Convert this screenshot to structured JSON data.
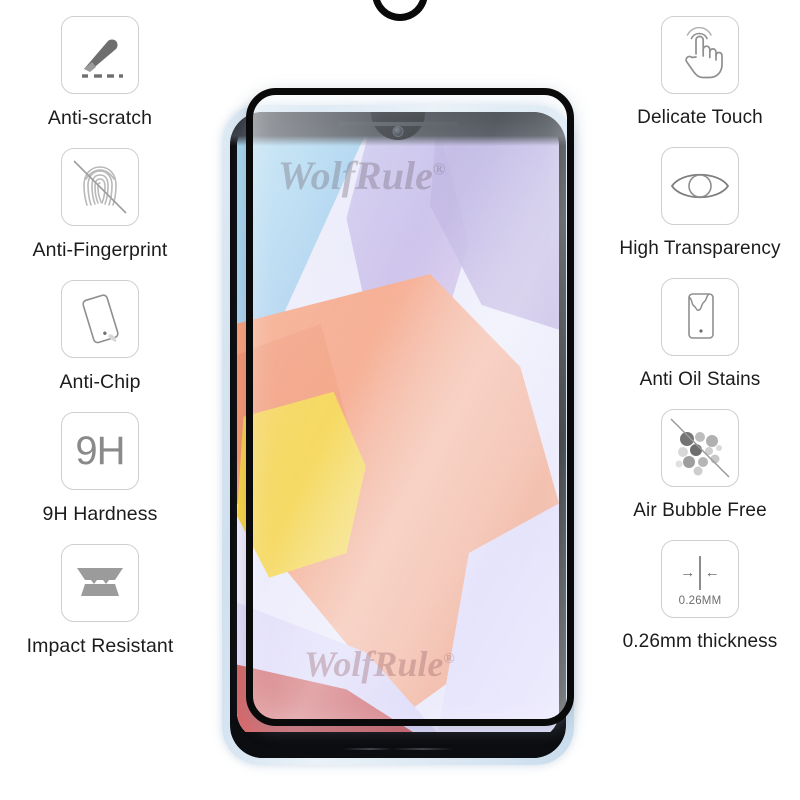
{
  "product": {
    "type": "tempered-glass-screen-protector",
    "brand_watermark": "WolfRule",
    "trademark_symbol": "®"
  },
  "watermarks": [
    {
      "text": "WolfRule",
      "mark": "®",
      "position": "upper-screen"
    },
    {
      "text": "WolfRule",
      "mark": "®",
      "position": "lower-screen"
    }
  ],
  "features_left": [
    {
      "icon": "knife-scratch-icon",
      "label": "Anti-scratch"
    },
    {
      "icon": "fingerprint-blocked-icon",
      "label": "Anti-Fingerprint"
    },
    {
      "icon": "phone-chip-icon",
      "label": "Anti-Chip"
    },
    {
      "icon": "nine-h-hardness-icon",
      "label": "9H Hardness",
      "icon_text": "9H"
    },
    {
      "icon": "impact-layers-icon",
      "label": "Impact Resistant"
    }
  ],
  "features_right": [
    {
      "icon": "touch-hand-icon",
      "label": "Delicate Touch"
    },
    {
      "icon": "eye-icon",
      "label": "High Transparency"
    },
    {
      "icon": "phone-oil-stain-icon",
      "label": "Anti Oil Stains"
    },
    {
      "icon": "bubbles-blocked-icon",
      "label": "Air Bubble Free"
    },
    {
      "icon": "thickness-caliper-icon",
      "label": "0.26mm thickness",
      "icon_text": "0.26MM"
    }
  ],
  "phone": {
    "body_color": "#d9e7f2",
    "screen_bezel_color": "#0c0d10",
    "notch_type": "waterdrop",
    "has_front_camera": true
  },
  "colors": {
    "icon_border": "#cfcfcf",
    "icon_fill": "#8a8a8a",
    "label_text": "#1c1c1c",
    "protector_border": "#0a0a0a",
    "background": "#ffffff"
  }
}
